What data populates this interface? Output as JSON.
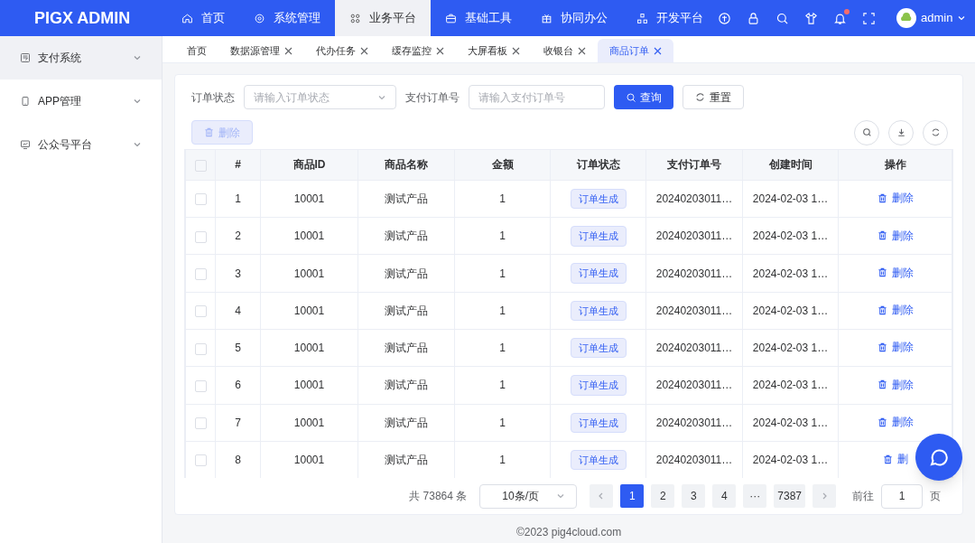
{
  "header": {
    "logo": "PIGX ADMIN",
    "nav": [
      {
        "label": "首页",
        "selected": false
      },
      {
        "label": "系统管理",
        "selected": false
      },
      {
        "label": "业务平台",
        "selected": true
      },
      {
        "label": "基础工具",
        "selected": false
      },
      {
        "label": "协同办公",
        "selected": false
      },
      {
        "label": "开发平台",
        "selected": false
      }
    ],
    "tools": [
      {
        "badge": false
      },
      {
        "badge": false
      },
      {
        "badge": false
      },
      {
        "badge": false
      },
      {
        "badge": true
      },
      {
        "badge": false
      }
    ],
    "user": "admin"
  },
  "sidebar": {
    "items": [
      {
        "label": "支付系统",
        "selected": true
      },
      {
        "label": "APP管理",
        "selected": false
      },
      {
        "label": "公众号平台",
        "selected": false
      }
    ]
  },
  "tabs": [
    {
      "label": "首页",
      "closable": false,
      "selected": false
    },
    {
      "label": "数据源管理",
      "closable": true,
      "selected": false
    },
    {
      "label": "代办任务",
      "closable": true,
      "selected": false
    },
    {
      "label": "缓存监控",
      "closable": true,
      "selected": false
    },
    {
      "label": "大屏看板",
      "closable": true,
      "selected": false
    },
    {
      "label": "收银台",
      "closable": true,
      "selected": false
    },
    {
      "label": "商品订单",
      "closable": true,
      "selected": true
    }
  ],
  "filters": [
    {
      "kind": "select",
      "label": "订单状态",
      "placeholder": "请输入订单状态"
    },
    {
      "kind": "input",
      "label": "支付订单号",
      "placeholder": "请输入支付订单号"
    }
  ],
  "search_button": "查询",
  "reset_button": "重置",
  "delete_button": {
    "label": "删除",
    "disabled": true
  },
  "table": {
    "select_all_checked": false,
    "columns": [
      "#",
      "商品ID",
      "商品名称",
      "金额",
      "订单状态",
      "支付订单号",
      "创建时间",
      "操作"
    ],
    "rows": [
      {
        "checked": false,
        "cells": [
          "1",
          "10001",
          "测试产品",
          "1",
          "订单生成",
          "20240203011…",
          "2024-02-03 1…"
        ],
        "action": "删除"
      },
      {
        "checked": false,
        "cells": [
          "2",
          "10001",
          "测试产品",
          "1",
          "订单生成",
          "20240203011…",
          "2024-02-03 1…"
        ],
        "action": "删除"
      },
      {
        "checked": false,
        "cells": [
          "3",
          "10001",
          "测试产品",
          "1",
          "订单生成",
          "20240203011…",
          "2024-02-03 1…"
        ],
        "action": "删除"
      },
      {
        "checked": false,
        "cells": [
          "4",
          "10001",
          "测试产品",
          "1",
          "订单生成",
          "20240203011…",
          "2024-02-03 1…"
        ],
        "action": "删除"
      },
      {
        "checked": false,
        "cells": [
          "5",
          "10001",
          "测试产品",
          "1",
          "订单生成",
          "20240203011…",
          "2024-02-03 1…"
        ],
        "action": "删除"
      },
      {
        "checked": false,
        "cells": [
          "6",
          "10001",
          "测试产品",
          "1",
          "订单生成",
          "20240203011…",
          "2024-02-03 1…"
        ],
        "action": "删除"
      },
      {
        "checked": false,
        "cells": [
          "7",
          "10001",
          "测试产品",
          "1",
          "订单生成",
          "20240203011…",
          "2024-02-03 1…"
        ],
        "action": "删除"
      },
      {
        "checked": false,
        "cells": [
          "8",
          "10001",
          "测试产品",
          "1",
          "订单生成",
          "20240203011…",
          "2024-02-03 1…"
        ],
        "action": "删"
      }
    ]
  },
  "pagination": {
    "total": "共 73864 条",
    "page_size": "10条/页",
    "pages": [
      {
        "label": "1",
        "selected": true
      },
      {
        "label": "2",
        "selected": false
      },
      {
        "label": "3",
        "selected": false
      },
      {
        "label": "4",
        "selected": false
      },
      {
        "label": "···",
        "selected": false
      },
      {
        "label": "7387",
        "selected": false
      }
    ],
    "jump_label": "前往",
    "jump_value": "1",
    "jump_suffix": "页"
  },
  "footer": "©2023 pig4cloud.com"
}
